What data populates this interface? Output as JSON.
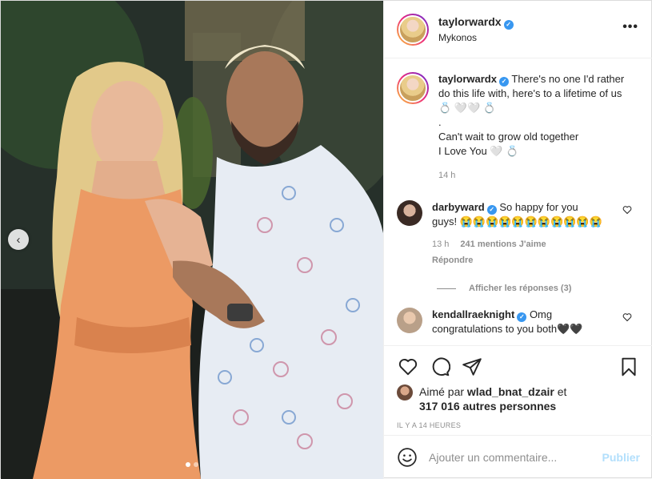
{
  "post": {
    "header": {
      "username": "taylorwardx",
      "location": "Mykonos",
      "verified_icon": "verified-badge-icon",
      "more_icon": "more-options-icon",
      "more_label": "•••"
    },
    "caption": {
      "username": "taylorwardx",
      "text_line1": "There's no one I'd rather do this life with, here's to a lifetime of us 💍 🤍🤍 💍",
      "text_line2": ".",
      "text_line3": "Can't wait to grow old together",
      "text_line4": "I Love You 🤍 💍",
      "time": "14 h"
    },
    "comments": [
      {
        "username": "darbyward",
        "text": "So happy for you guys! 😭😭😭😭😭😭😭😭😭😭😭",
        "time": "13 h",
        "likes": "241 mentions J'aime",
        "reply": "Répondre",
        "view_replies": "Afficher les réponses (3)"
      },
      {
        "username": "kendallraeknight",
        "text": "Omg congratulations to you both🖤🖤"
      }
    ],
    "liked_by": {
      "prefix": "Aimé par",
      "user": "wlad_bnat_dzair",
      "connector": "et",
      "others": "317 016 autres personnes"
    },
    "post_time": "IL Y A 14 HEURES",
    "add_comment": {
      "placeholder": "Ajouter un commentaire...",
      "post_label": "Publier"
    },
    "carousel": {
      "prev_label": "‹",
      "dot_count": 2,
      "active_index": 0
    }
  }
}
